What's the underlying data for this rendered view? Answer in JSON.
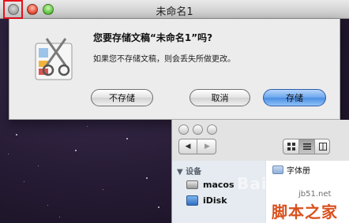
{
  "window": {
    "title": "未命名1"
  },
  "sheet": {
    "title": "您要存储文稿“未命名1”吗?",
    "message": "如果您不存储文稿，则会丢失所做更改。",
    "buttons": {
      "dont_save": "不存储",
      "cancel": "取消",
      "save": "存储"
    },
    "default_button_color": "#4a8ee4"
  },
  "finder": {
    "sidebar_header": "▼ 设备",
    "devices": [
      {
        "label": "macos",
        "icon": "hard-drive-icon"
      },
      {
        "label": "iDisk",
        "icon": "idisk-icon"
      }
    ],
    "column_item": "字体册",
    "nav": {
      "back": "◀",
      "forward": "▶"
    }
  },
  "watermark": {
    "baidu": "Bai经",
    "url": "jb51.net",
    "site": "脚本之家"
  },
  "highlight_color": "#e8111b"
}
